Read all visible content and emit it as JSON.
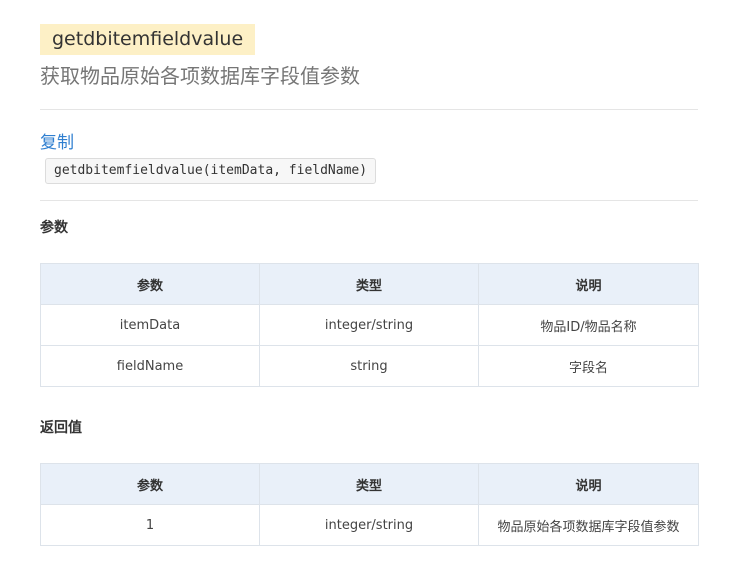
{
  "function": {
    "name": "getdbitemfieldvalue",
    "description": "获取物品原始各项数据库字段值参数"
  },
  "copy_label": "复制",
  "signature": "getdbitemfieldvalue(itemData, fieldName)",
  "params_section": {
    "title": "参数",
    "headers": [
      "参数",
      "类型",
      "说明"
    ],
    "rows": [
      [
        "itemData",
        "integer/string",
        "物品ID/物品名称"
      ],
      [
        "fieldName",
        "string",
        "字段名"
      ]
    ]
  },
  "return_section": {
    "title": "返回值",
    "headers": [
      "参数",
      "类型",
      "说明"
    ],
    "rows": [
      [
        "1",
        "integer/string",
        "物品原始各项数据库字段值参数"
      ]
    ]
  }
}
